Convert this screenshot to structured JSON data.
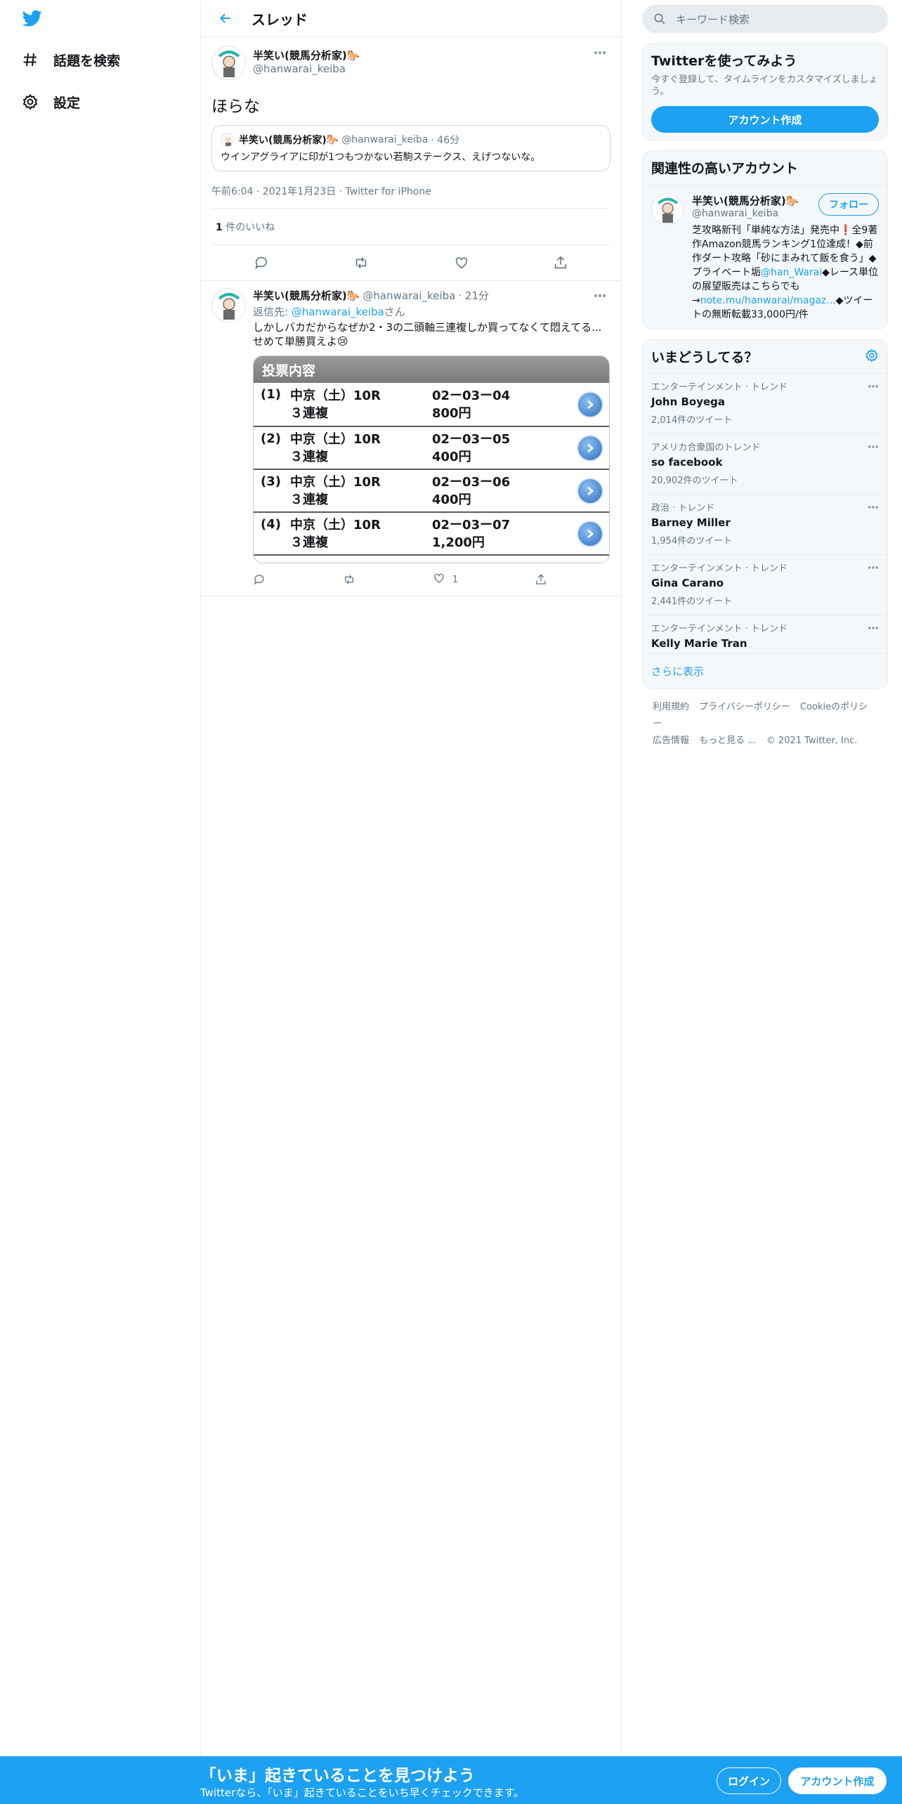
{
  "nav": {
    "explore_label": "話題を検索",
    "settings_label": "設定"
  },
  "header": {
    "title": "スレッド"
  },
  "main_tweet": {
    "display_name": "半笑い(競馬分析家)",
    "handle": "@hanwarai_keiba",
    "text": "ほらな",
    "quote": {
      "display_name": "半笑い(競馬分析家)",
      "handle": "@hanwarai_keiba",
      "time": "· 46分",
      "text": "ウインアグライアに印が1つもつかない若駒ステークス、えげつないな。"
    },
    "meta": "午前6:04 · 2021年1月23日 · Twitter for iPhone",
    "likes_count": "1",
    "likes_label": " 件のいいね"
  },
  "reply_tweet": {
    "display_name": "半笑い(競馬分析家)",
    "handle": "@hanwarai_keiba",
    "time": "· 21分",
    "replying_prefix": "返信先: ",
    "replying_handle": "@hanwarai_keiba",
    "replying_suffix": "さん",
    "text": "しかしバカだからなぜか2・3の二頭軸三連複しか買ってなくて悶えてる...せめて単勝買えよ😢",
    "like_count": "1",
    "media": {
      "header": "投票内容",
      "rows": [
        {
          "num": "(1)",
          "race": "中京（土）10R",
          "type": "３連複",
          "combo": "02ー03ー04",
          "amount": "800円"
        },
        {
          "num": "(2)",
          "race": "中京（土）10R",
          "type": "３連複",
          "combo": "02ー03ー05",
          "amount": "400円"
        },
        {
          "num": "(3)",
          "race": "中京（土）10R",
          "type": "３連複",
          "combo": "02ー03ー06",
          "amount": "400円"
        },
        {
          "num": "(4)",
          "race": "中京（土）10R",
          "type": "３連複",
          "combo": "02ー03ー07",
          "amount": "1,200円"
        }
      ]
    }
  },
  "search": {
    "placeholder": "キーワード検索"
  },
  "signup_card": {
    "title": "Twitterを使ってみよう",
    "subtitle": "今すぐ登録して、タイムラインをカスタマイズしましょう。",
    "button": "アカウント作成"
  },
  "relevant": {
    "title": "関連性の高いアカウント",
    "display_name": "半笑い(競馬分析家)",
    "handle": "@hanwarai_keiba",
    "follow": "フォロー",
    "bio_1": "芝攻略新刊「単純な方法」発売中❗全9著作Amazon競馬ランキング1位達成！◆前作ダート攻略「砂にまみれて飯を食う」◆プライベート垢",
    "bio_link1": "@han_Warai",
    "bio_2": "◆レース単位の展望販売はこちらでも→",
    "bio_link2": "note.mu/hanwarai/magaz...",
    "bio_3": "◆ツイートの無断転載33,000円/件"
  },
  "trends": {
    "title": "いまどうしてる？",
    "items": [
      {
        "meta": "エンターテインメント · トレンド",
        "name": "John Boyega",
        "count": "2,014件のツイート"
      },
      {
        "meta": "アメリカ合衆国のトレンド",
        "name": "so facebook",
        "count": "20,902件のツイート"
      },
      {
        "meta": "政治 · トレンド",
        "name": "Barney Miller",
        "count": "1,954件のツイート"
      },
      {
        "meta": "エンターテインメント · トレンド",
        "name": "Gina Carano",
        "count": "2,441件のツイート"
      },
      {
        "meta": "エンターテインメント · トレンド",
        "name": "Kelly Marie Tran",
        "count": ""
      }
    ],
    "show_more": "さらに表示"
  },
  "footer": {
    "terms": "利用規約",
    "privacy": "プライバシーポリシー",
    "cookie": "Cookieのポリシー",
    "ads": "広告情報",
    "more": "もっと見る ...",
    "copyright": "© 2021 Twitter, Inc."
  },
  "bottom_bar": {
    "title": "「いま」起きていることを見つけよう",
    "subtitle": "Twitterなら、「いま」起きていることをいち早くチェックできます。",
    "login": "ログイン",
    "signup": "アカウント作成"
  },
  "colors": {
    "accent": "#1da1f2",
    "muted": "#657786",
    "border": "#e6ecf0"
  }
}
